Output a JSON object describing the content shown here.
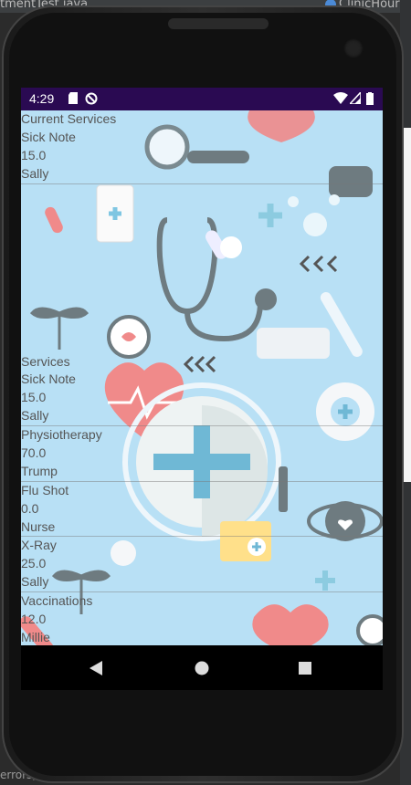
{
  "ide": {
    "tab_left": "tmentTest.java",
    "tab_right": "ClinicHour",
    "bottom_text": "errors)"
  },
  "status_bar": {
    "time": "4:29",
    "icons": [
      "sd-card-icon",
      "no-sync-icon",
      "wifi-icon",
      "signal-icon",
      "battery-icon"
    ]
  },
  "current_services": {
    "header": "Current Services",
    "items": [
      {
        "name": "Sick Note",
        "price": "15.0",
        "provider": "Sally"
      }
    ]
  },
  "services": {
    "header": "Services",
    "items": [
      {
        "name": "Sick Note",
        "price": "15.0",
        "provider": "Sally"
      },
      {
        "name": "Physiotherapy",
        "price": "70.0",
        "provider": "Trump"
      },
      {
        "name": "Flu Shot",
        "price": "0.0",
        "provider": "Nurse"
      },
      {
        "name": "X-Ray",
        "price": "25.0",
        "provider": "Sally"
      },
      {
        "name": "Vaccinations",
        "price": "12.0",
        "provider": "Millie"
      }
    ]
  },
  "nav": {
    "back": "back-icon",
    "home": "home-icon",
    "recents": "recents-icon"
  },
  "colors": {
    "status_bar": "#2a0a52",
    "background": "#b8e0f5",
    "text": "#555555"
  }
}
